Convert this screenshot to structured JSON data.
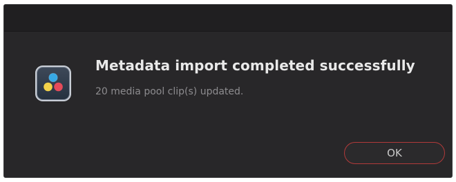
{
  "dialog": {
    "icon": "davinci-resolve-app-icon",
    "title": "Metadata import completed successfully",
    "message": "20 media pool clip(s) updated.",
    "ok_label": "OK"
  },
  "colors": {
    "dialog_bg": "#282729",
    "titlebar_bg": "#201f21",
    "button_border": "#b23a3a",
    "title_text": "#e9e9e9",
    "message_text": "#8d8c8f"
  }
}
